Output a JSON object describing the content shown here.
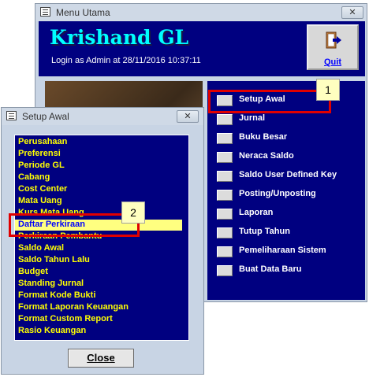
{
  "main_window": {
    "title": "Menu Utama",
    "close_glyph": "✕",
    "app_title": "Krishand GL",
    "login_text": "Login as Admin at 28/11/2016 10:37:11",
    "quit_label": "Quit",
    "menu_items": [
      "Setup Awal",
      "Jurnal",
      "Buku Besar",
      "Neraca Saldo",
      "Saldo User Defined Key",
      "Posting/Unposting",
      "Laporan",
      "Tutup Tahun",
      "Pemeliharaan Sistem",
      "Buat Data Baru"
    ]
  },
  "setup_dialog": {
    "title": "Setup Awal",
    "close_glyph": "✕",
    "items": [
      "Perusahaan",
      "Preferensi",
      "Periode GL",
      "Cabang",
      "Cost Center",
      "Mata Uang",
      "Kurs Mata Uang",
      "Daftar Perkiraan",
      "Perkiraan Pembantu",
      "Saldo Awal",
      "Saldo Tahun Lalu",
      "Budget",
      "Standing Jurnal",
      "Format Kode Bukti",
      "Format Laporan Keuangan",
      "Format Custom Report",
      "Rasio Keuangan"
    ],
    "close_button": "Close"
  },
  "annotations": {
    "callout_1": "1",
    "callout_2": "2"
  },
  "colors": {
    "navy": "#000080",
    "title_cyan": "#00ffff",
    "list_text": "#ffff00",
    "annotation_red": "#e00000"
  }
}
